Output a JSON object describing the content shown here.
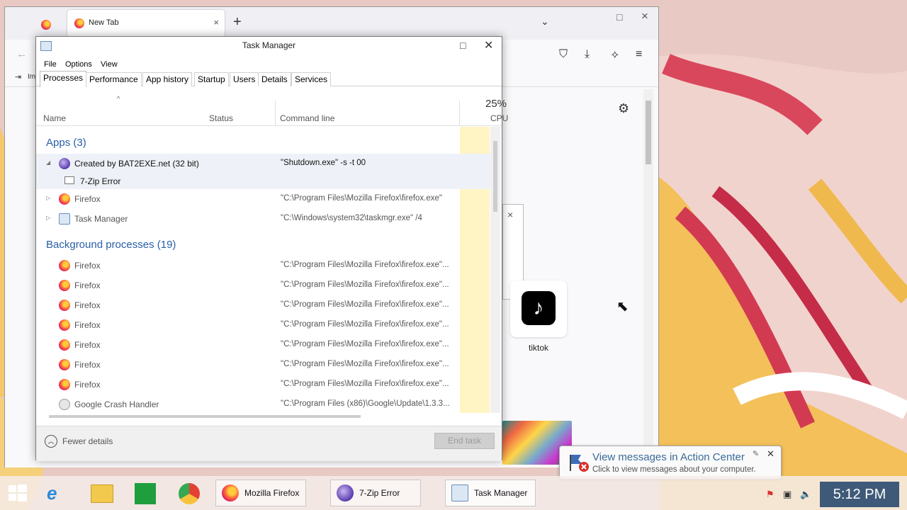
{
  "firefox": {
    "tab_title": "New Tab",
    "tab_close": "×",
    "newtab": "+",
    "list_tabs": "⌄",
    "maximize": "□",
    "close": "×",
    "toolbar_partial": "Im",
    "shortcut_label": "tiktok",
    "dialog_close": "×"
  },
  "taskmanager": {
    "title": "Task Manager",
    "menu": [
      "File",
      "Options",
      "View"
    ],
    "tabs": [
      "Processes",
      "Performance",
      "App history",
      "Startup",
      "Users",
      "Details",
      "Services"
    ],
    "columns": {
      "name": "Name",
      "status": "Status",
      "command": "Command line",
      "cpu_pct": "25%",
      "cpu": "CPU"
    },
    "groups": {
      "apps": "Apps (3)",
      "background": "Background processes (19)"
    },
    "apps": [
      {
        "name": "Created by BAT2EXE.net (32 bit)",
        "cmd": "\"Shutdown.exe\" -s -t 00",
        "expanded": true,
        "child": "7-Zip Error"
      },
      {
        "name": "Firefox",
        "cmd": "\"C:\\Program Files\\Mozilla Firefox\\firefox.exe\""
      },
      {
        "name": "Task Manager",
        "cmd": "\"C:\\Windows\\system32\\taskmgr.exe\" /4"
      }
    ],
    "background": [
      {
        "name": "Firefox",
        "cmd": "\"C:\\Program Files\\Mozilla Firefox\\firefox.exe\"..."
      },
      {
        "name": "Firefox",
        "cmd": "\"C:\\Program Files\\Mozilla Firefox\\firefox.exe\"..."
      },
      {
        "name": "Firefox",
        "cmd": "\"C:\\Program Files\\Mozilla Firefox\\firefox.exe\"..."
      },
      {
        "name": "Firefox",
        "cmd": "\"C:\\Program Files\\Mozilla Firefox\\firefox.exe\"..."
      },
      {
        "name": "Firefox",
        "cmd": "\"C:\\Program Files\\Mozilla Firefox\\firefox.exe\"..."
      },
      {
        "name": "Firefox",
        "cmd": "\"C:\\Program Files\\Mozilla Firefox\\firefox.exe\"..."
      },
      {
        "name": "Firefox",
        "cmd": "\"C:\\Program Files\\Mozilla Firefox\\firefox.exe\"..."
      },
      {
        "name": "Google Crash Handler",
        "cmd": "\"C:\\Program Files (x86)\\Google\\Update\\1.3.3..."
      }
    ],
    "fewer_details": "Fewer details",
    "end_task": "End task"
  },
  "toast": {
    "title": "View messages in Action Center",
    "body": "Click to view messages about your computer."
  },
  "taskbar": {
    "buttons": [
      "Mozilla Firefox",
      "7-Zip Error",
      "Task Manager"
    ],
    "clock": "5:12 PM"
  }
}
